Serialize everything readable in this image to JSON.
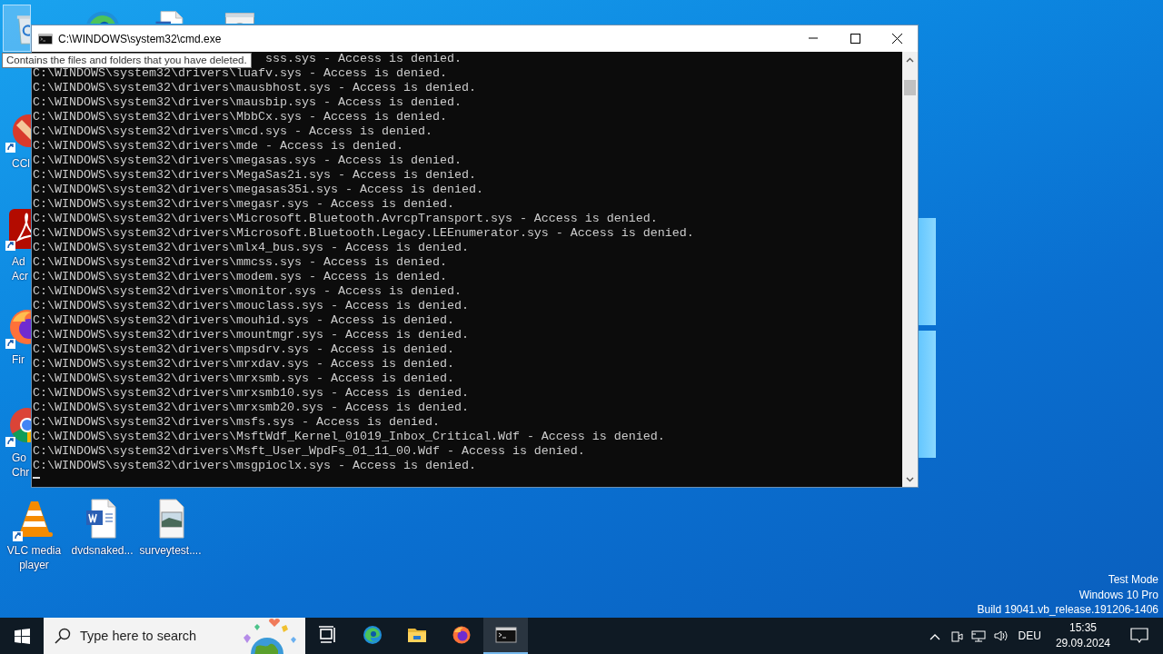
{
  "desktop": {
    "top_icons": [
      {
        "kind": "recycle-bin",
        "selected": true
      },
      {
        "kind": "edge",
        "selected": false
      },
      {
        "kind": "word-doc",
        "selected": false
      },
      {
        "kind": "setup",
        "selected": false
      }
    ],
    "left_icons": [
      {
        "kind": "ccleaner",
        "shortcut": true,
        "label_lines": [
          "CCl"
        ]
      },
      {
        "kind": "acrobat",
        "shortcut": true,
        "label_lines": [
          "Ad",
          "Acr"
        ]
      },
      {
        "kind": "firefox",
        "shortcut": true,
        "label_lines": [
          "Fir"
        ]
      },
      {
        "kind": "chrome",
        "shortcut": true,
        "label_lines": [
          "Go",
          "Chr"
        ]
      }
    ],
    "bottom_icons": [
      {
        "kind": "vlc",
        "shortcut": true,
        "label": "VLC media player"
      },
      {
        "kind": "word-doc",
        "shortcut": false,
        "label": "dvdsnaked..."
      },
      {
        "kind": "image-file",
        "shortcut": false,
        "label": "surveytest...."
      }
    ],
    "tooltip": "Contains the files and folders that you have deleted.",
    "system_info_lines": [
      "Test Mode",
      "Windows 10 Pro",
      "Build 19041.vb_release.191206-1406"
    ]
  },
  "console_window": {
    "title": "C:\\WINDOWS\\system32\\cmd.exe",
    "partial_line": "sss.sys - Access is denied.",
    "lines": [
      "C:\\WINDOWS\\system32\\drivers\\luafv.sys - Access is denied.",
      "C:\\WINDOWS\\system32\\drivers\\mausbhost.sys - Access is denied.",
      "C:\\WINDOWS\\system32\\drivers\\mausbip.sys - Access is denied.",
      "C:\\WINDOWS\\system32\\drivers\\MbbCx.sys - Access is denied.",
      "C:\\WINDOWS\\system32\\drivers\\mcd.sys - Access is denied.",
      "C:\\WINDOWS\\system32\\drivers\\mde - Access is denied.",
      "C:\\WINDOWS\\system32\\drivers\\megasas.sys - Access is denied.",
      "C:\\WINDOWS\\system32\\drivers\\MegaSas2i.sys - Access is denied.",
      "C:\\WINDOWS\\system32\\drivers\\megasas35i.sys - Access is denied.",
      "C:\\WINDOWS\\system32\\drivers\\megasr.sys - Access is denied.",
      "C:\\WINDOWS\\system32\\drivers\\Microsoft.Bluetooth.AvrcpTransport.sys - Access is denied.",
      "C:\\WINDOWS\\system32\\drivers\\Microsoft.Bluetooth.Legacy.LEEnumerator.sys - Access is denied.",
      "C:\\WINDOWS\\system32\\drivers\\mlx4_bus.sys - Access is denied.",
      "C:\\WINDOWS\\system32\\drivers\\mmcss.sys - Access is denied.",
      "C:\\WINDOWS\\system32\\drivers\\modem.sys - Access is denied.",
      "C:\\WINDOWS\\system32\\drivers\\monitor.sys - Access is denied.",
      "C:\\WINDOWS\\system32\\drivers\\mouclass.sys - Access is denied.",
      "C:\\WINDOWS\\system32\\drivers\\mouhid.sys - Access is denied.",
      "C:\\WINDOWS\\system32\\drivers\\mountmgr.sys - Access is denied.",
      "C:\\WINDOWS\\system32\\drivers\\mpsdrv.sys - Access is denied.",
      "C:\\WINDOWS\\system32\\drivers\\mrxdav.sys - Access is denied.",
      "C:\\WINDOWS\\system32\\drivers\\mrxsmb.sys - Access is denied.",
      "C:\\WINDOWS\\system32\\drivers\\mrxsmb10.sys - Access is denied.",
      "C:\\WINDOWS\\system32\\drivers\\mrxsmb20.sys - Access is denied.",
      "C:\\WINDOWS\\system32\\drivers\\msfs.sys - Access is denied.",
      "C:\\WINDOWS\\system32\\drivers\\MsftWdf_Kernel_01019_Inbox_Critical.Wdf - Access is denied.",
      "C:\\WINDOWS\\system32\\drivers\\Msft_User_WpdFs_01_11_00.Wdf - Access is denied.",
      "C:\\WINDOWS\\system32\\drivers\\msgpioclx.sys - Access is denied."
    ]
  },
  "taskbar": {
    "search_placeholder": "Type here to search",
    "pinned": [
      {
        "kind": "task-view",
        "selected": false
      },
      {
        "kind": "edge",
        "selected": false
      },
      {
        "kind": "explorer",
        "selected": false
      },
      {
        "kind": "firefox",
        "selected": false
      },
      {
        "kind": "cmd",
        "selected": true
      }
    ],
    "tray": {
      "language": "DEU",
      "time": "15:35",
      "date": "29.09.2024"
    }
  }
}
